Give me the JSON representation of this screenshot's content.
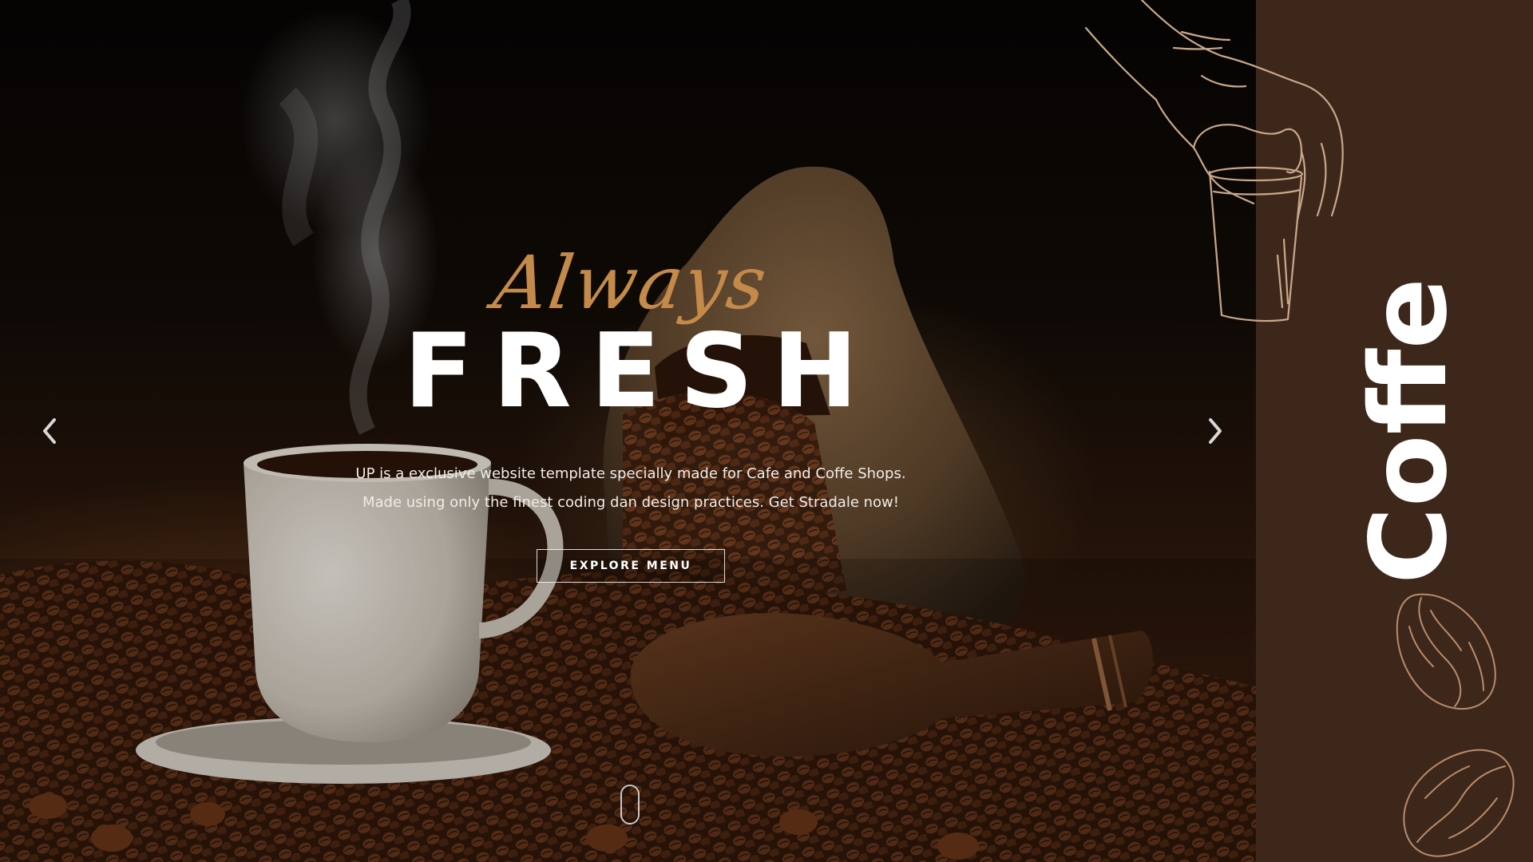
{
  "hero": {
    "script_title": "Always",
    "main_title": "FRESH",
    "description_line1": "UP is a exclusive website template specially made for Cafe and Coffe Shops.",
    "description_line2": "Made using only the finest coding dan design practices. Get Stradale now!",
    "cta_label": "EXPLORE MENU",
    "prev_icon": "chevron-left-icon",
    "next_icon": "chevron-right-icon",
    "scroll_icon": "mouse-scroll-icon"
  },
  "side_panel": {
    "vertical_word": "Coffe",
    "background_color": "#3d271b",
    "icons": [
      "hand-holding-cup-icon",
      "coffee-bean-icon",
      "coffee-bean-icon"
    ]
  },
  "colors": {
    "accent_script": "#c48a4a",
    "title_text": "#ffffff",
    "line_art": "#c9a88a"
  }
}
